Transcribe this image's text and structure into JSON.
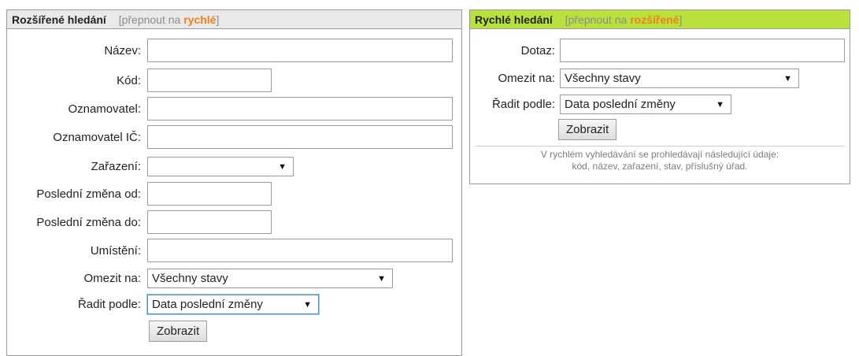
{
  "advanced": {
    "title": "Rozšířené hledání",
    "switch_prefix": "[přepnout na ",
    "switch_link": "rychlé",
    "switch_suffix": "]",
    "fields": {
      "nazev": {
        "label": "Název:",
        "value": ""
      },
      "kod": {
        "label": "Kód:",
        "value": ""
      },
      "oznamovatel": {
        "label": "Oznamovatel:",
        "value": ""
      },
      "oznamovatel_ic": {
        "label": "Oznamovatel IČ:",
        "value": ""
      },
      "zarazeni": {
        "label": "Zařazení:",
        "value": ""
      },
      "zmena_od": {
        "label": "Poslední změna od:",
        "value": ""
      },
      "zmena_do": {
        "label": "Poslední změna do:",
        "value": ""
      },
      "umisteni": {
        "label": "Umístění:",
        "value": ""
      },
      "omezit": {
        "label": "Omezit na:",
        "value": "Všechny stavy"
      },
      "radit": {
        "label": "Řadit podle:",
        "value": "Data poslední změny"
      }
    },
    "submit_label": "Zobrazit"
  },
  "quick": {
    "title": "Rychlé hledání",
    "switch_prefix": "[přepnout na ",
    "switch_link": "rozšířené",
    "switch_suffix": "]",
    "fields": {
      "dotaz": {
        "label": "Dotaz:",
        "value": ""
      },
      "omezit": {
        "label": "Omezit na:",
        "value": "Všechny stavy"
      },
      "radit": {
        "label": "Řadit podle:",
        "value": "Data poslední změny"
      }
    },
    "submit_label": "Zobrazit",
    "hint_line1": "V rychlém vyhledávání se prohledávají následující údaje:",
    "hint_line2": "kód, název, zařazení, stav, příslušný úřad."
  },
  "icons": {
    "dropdown": "chevron-down-icon"
  },
  "colors": {
    "advanced_header_bg": "#e9e9e9",
    "quick_header_bg": "#b9e13b",
    "switch_link": "#f07f1e",
    "switch_text": "#8c8c8c"
  }
}
